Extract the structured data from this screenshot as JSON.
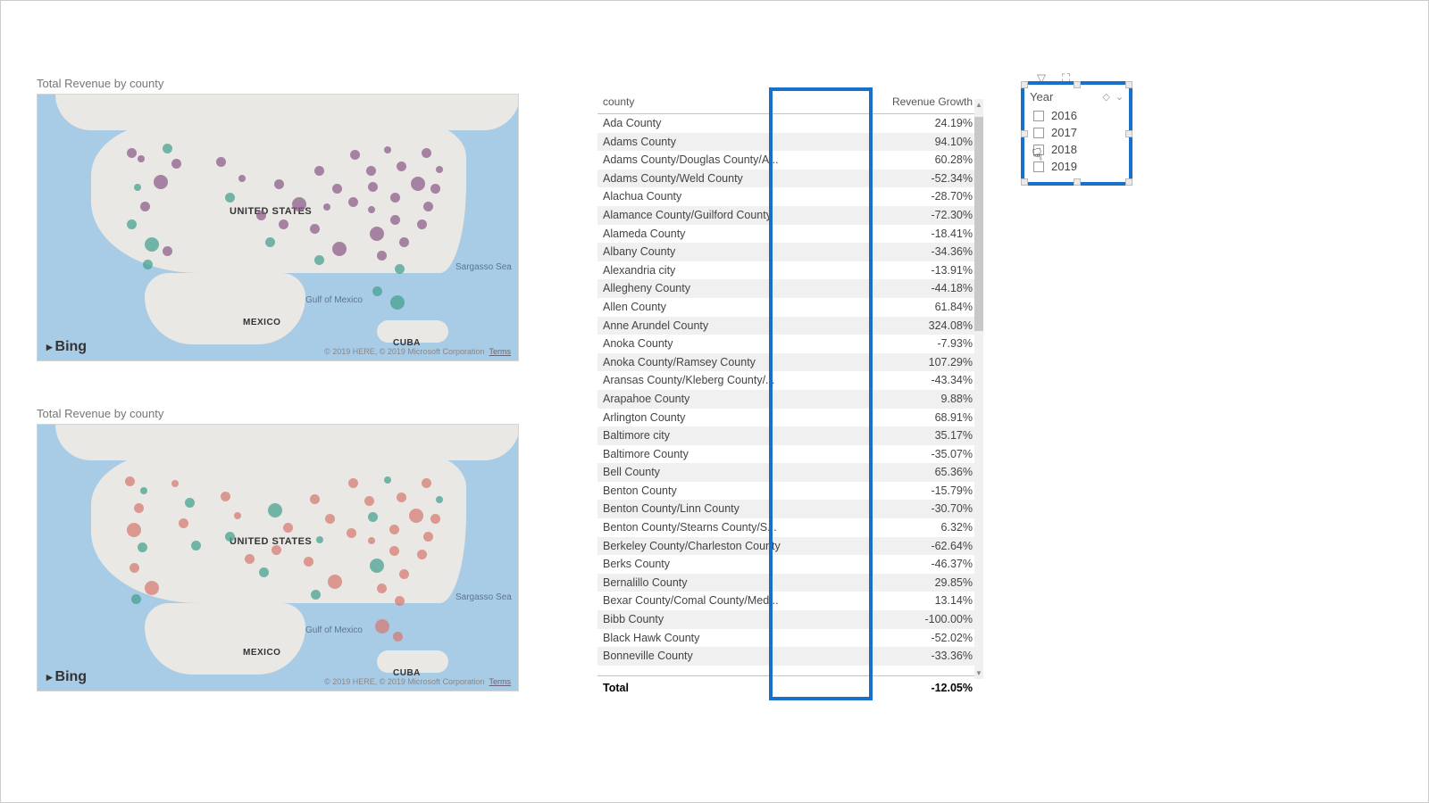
{
  "maps": {
    "title": "Total Revenue by county",
    "label_us": "UNITED STATES",
    "label_mex": "MEXICO",
    "label_cuba": "CUBA",
    "label_gulf": "Gulf of Mexico",
    "label_sargasso": "Sargasso Sea",
    "logo": "Bing",
    "copyright": "© 2019 HERE, © 2019 Microsoft Corporation",
    "terms": "Terms"
  },
  "table": {
    "headers": {
      "county": "county",
      "growth": "Revenue Growth"
    },
    "rows": [
      {
        "county": "Ada County",
        "growth": "24.19%"
      },
      {
        "county": "Adams County",
        "growth": "94.10%"
      },
      {
        "county": "Adams County/Douglas County/A...",
        "growth": "60.28%"
      },
      {
        "county": "Adams County/Weld County",
        "growth": "-52.34%"
      },
      {
        "county": "Alachua County",
        "growth": "-28.70%"
      },
      {
        "county": "Alamance County/Guilford County",
        "growth": "-72.30%"
      },
      {
        "county": "Alameda County",
        "growth": "-18.41%"
      },
      {
        "county": "Albany County",
        "growth": "-34.36%"
      },
      {
        "county": "Alexandria city",
        "growth": "-13.91%"
      },
      {
        "county": "Allegheny County",
        "growth": "-44.18%"
      },
      {
        "county": "Allen County",
        "growth": "61.84%"
      },
      {
        "county": "Anne Arundel County",
        "growth": "324.08%"
      },
      {
        "county": "Anoka County",
        "growth": "-7.93%"
      },
      {
        "county": "Anoka County/Ramsey County",
        "growth": "107.29%"
      },
      {
        "county": "Aransas County/Kleberg County/...",
        "growth": "-43.34%"
      },
      {
        "county": "Arapahoe County",
        "growth": "9.88%"
      },
      {
        "county": "Arlington County",
        "growth": "68.91%"
      },
      {
        "county": "Baltimore city",
        "growth": "35.17%"
      },
      {
        "county": "Baltimore County",
        "growth": "-35.07%"
      },
      {
        "county": "Bell County",
        "growth": "65.36%"
      },
      {
        "county": "Benton County",
        "growth": "-15.79%"
      },
      {
        "county": "Benton County/Linn County",
        "growth": "-30.70%"
      },
      {
        "county": "Benton County/Stearns County/S...",
        "growth": "6.32%"
      },
      {
        "county": "Berkeley County/Charleston County",
        "growth": "-62.64%"
      },
      {
        "county": "Berks County",
        "growth": "-46.37%"
      },
      {
        "county": "Bernalillo County",
        "growth": "29.85%"
      },
      {
        "county": "Bexar County/Comal County/Med...",
        "growth": "13.14%"
      },
      {
        "county": "Bibb County",
        "growth": "-100.00%"
      },
      {
        "county": "Black Hawk County",
        "growth": "-52.02%"
      },
      {
        "county": "Bonneville County",
        "growth": "-33.36%"
      }
    ],
    "total_label": "Total",
    "total_value": "-12.05%"
  },
  "slicer": {
    "title": "Year",
    "items": [
      "2016",
      "2017",
      "2018",
      "2019"
    ]
  }
}
